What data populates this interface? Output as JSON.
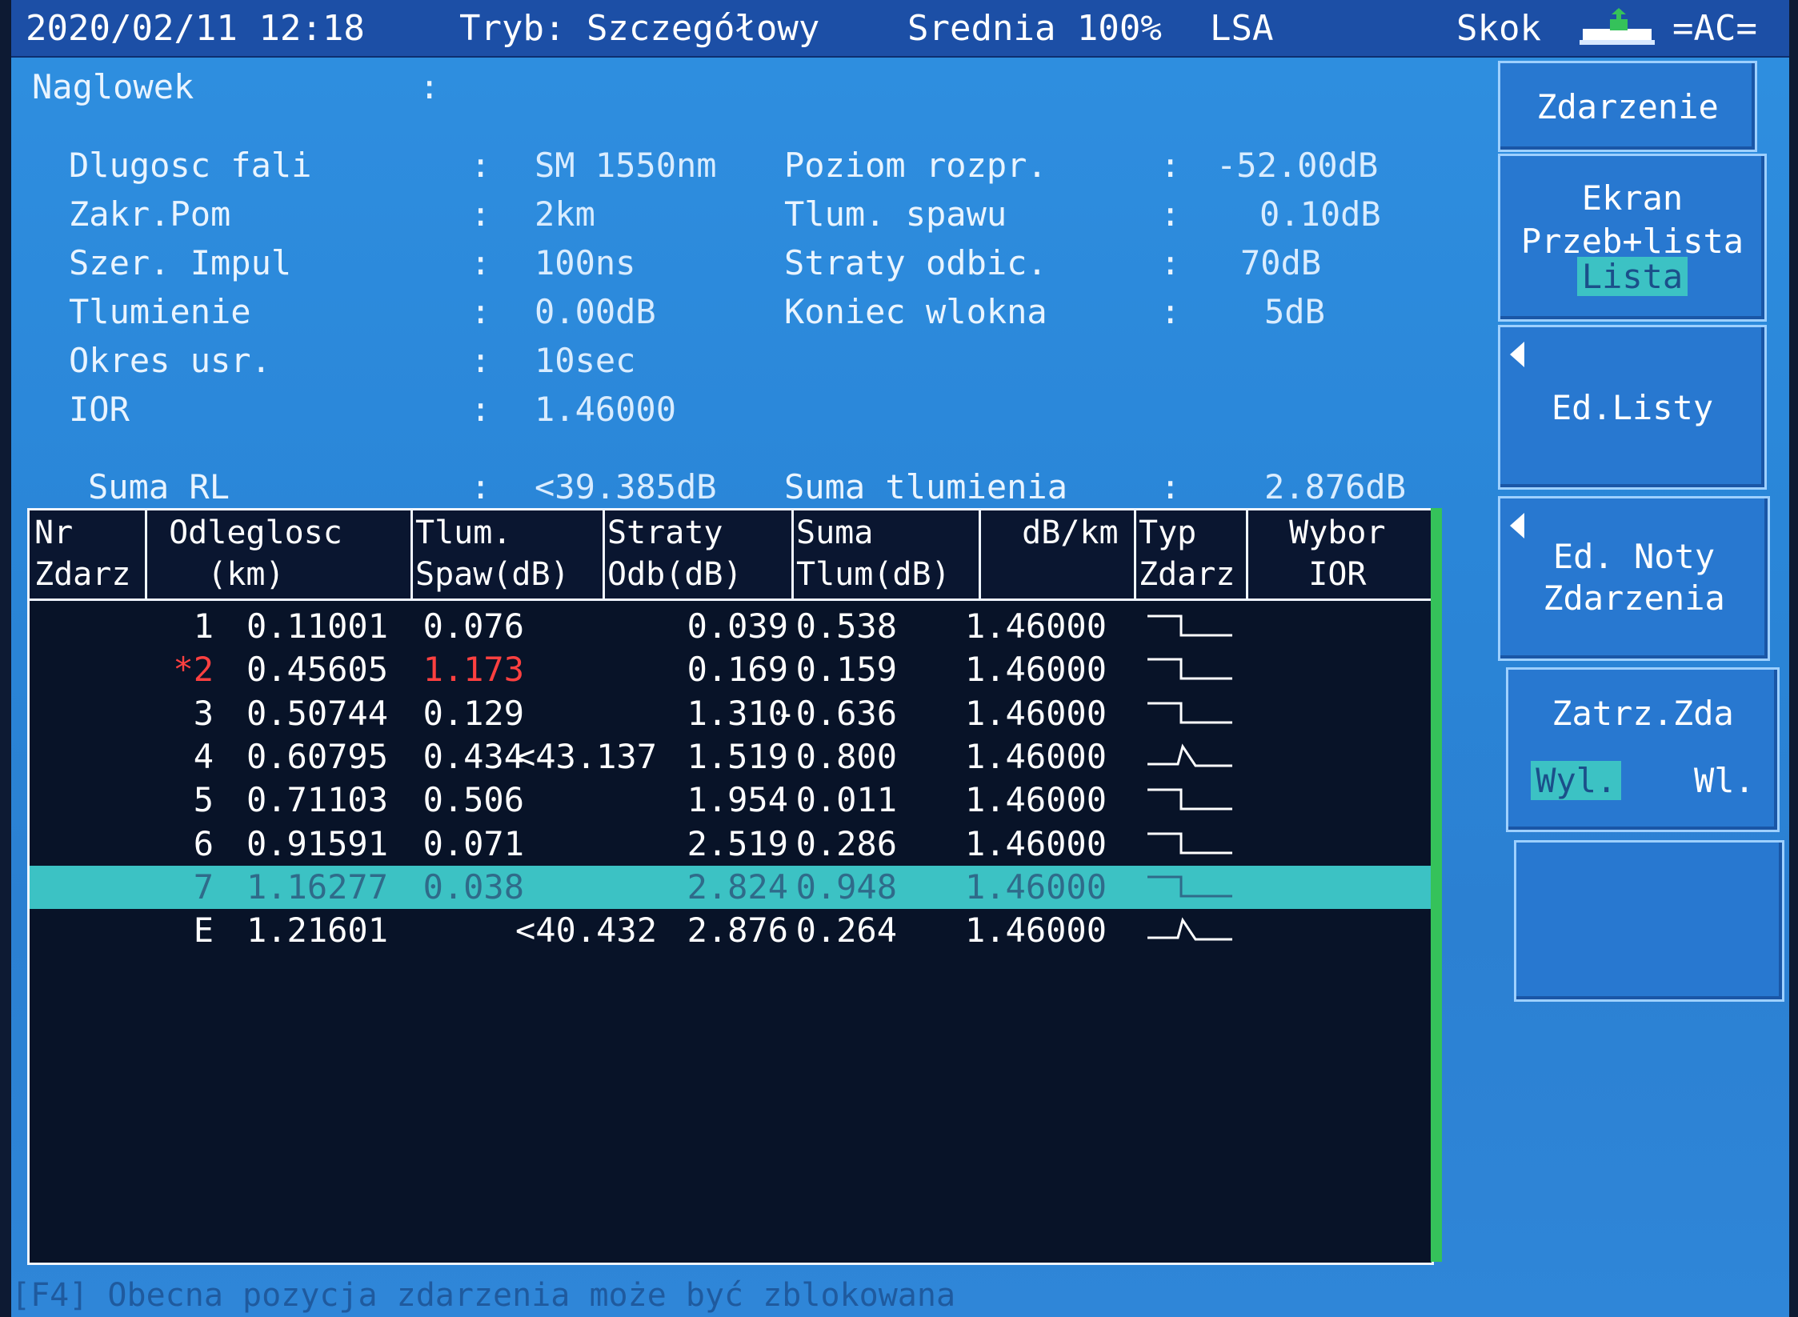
{
  "status": {
    "datetime": "2020/02/11 12:18",
    "mode": "Tryb: Szczegółowy",
    "average": "Srednia 100%",
    "lsa": "LSA",
    "skok": "Skok",
    "power": "=AC="
  },
  "header": {
    "title": "Naglowek",
    "title_colon": ":",
    "left": [
      {
        "label": "Dlugosc fali",
        "value": "SM 1550nm"
      },
      {
        "label": "Zakr.Pom",
        "value": "2km"
      },
      {
        "label": "Szer. Impul",
        "value": "100ns"
      },
      {
        "label": "Tlumienie",
        "value": "0.00dB"
      },
      {
        "label": "Okres usr.",
        "value": "10sec"
      },
      {
        "label": "IOR",
        "value": "1.46000"
      }
    ],
    "right": [
      {
        "label": "Poziom rozpr.",
        "value": "-52.00dB"
      },
      {
        "label": "Tlum. spawu",
        "value": "0.10dB"
      },
      {
        "label": "Straty odbic.",
        "value": "70dB"
      },
      {
        "label": "Koniec wlokna",
        "value": "5dB"
      }
    ],
    "suma_rl_label": "Suma RL",
    "suma_rl_value": "<39.385dB",
    "suma_tl_label": "Suma tlumienia",
    "suma_tl_value": "2.876dB",
    "colon": ":"
  },
  "table": {
    "columns": [
      "Nr\nZdarz",
      " Odleglosc\n   (km)",
      "Tlum.\nSpaw(dB)",
      "Straty\nOdb(dB)",
      "Suma\nTlum(dB)",
      "  dB/km",
      "Typ\nZdarz",
      "  Wybor\n   IOR"
    ],
    "rows": [
      {
        "nr": "1",
        "dist": "0.11001",
        "splice": "0.076",
        "refl": "",
        "total": "0.039",
        "dbkm": "0.538",
        "type": "step",
        "ior": "1.46000"
      },
      {
        "nr": "*2",
        "dist": "0.45605",
        "splice": "1.173",
        "refl": "",
        "total": "0.169",
        "dbkm": "0.159",
        "type": "step",
        "ior": "1.46000"
      },
      {
        "nr": "3",
        "dist": "0.50744",
        "splice": "0.129",
        "refl": "",
        "total": "1.310",
        "dbkm": "-0.636",
        "type": "step",
        "ior": "1.46000"
      },
      {
        "nr": "4",
        "dist": "0.60795",
        "splice": "0.434",
        "refl": "<43.137",
        "total": "1.519",
        "dbkm": "0.800",
        "type": "reflective",
        "ior": "1.46000"
      },
      {
        "nr": "5",
        "dist": "0.71103",
        "splice": "0.506",
        "refl": "",
        "total": "1.954",
        "dbkm": "0.011",
        "type": "step",
        "ior": "1.46000"
      },
      {
        "nr": "6",
        "dist": "0.91591",
        "splice": "0.071",
        "refl": "",
        "total": "2.519",
        "dbkm": "0.286",
        "type": "step",
        "ior": "1.46000"
      },
      {
        "nr": "7",
        "dist": "1.16277",
        "splice": "0.038",
        "refl": "",
        "total": "2.824",
        "dbkm": "0.948",
        "type": "step",
        "ior": "1.46000"
      },
      {
        "nr": "E",
        "dist": "1.21601",
        "splice": "",
        "refl": "<40.432",
        "total": "2.876",
        "dbkm": "0.264",
        "type": "reflective",
        "ior": "1.46000"
      }
    ]
  },
  "softkeys": {
    "event": "Zdarzenie",
    "screen_title": "Ekran",
    "screen_opt1": "Przeb+lista",
    "screen_opt2": "Lista",
    "edit_list": "Ed.Listy",
    "edit_notes_1": "Ed. Noty",
    "edit_notes_2": "Zdarzenia",
    "lock_title": "Zatrz.Zda",
    "lock_off": "Wyl.",
    "lock_on": "Wl."
  },
  "footer": "[F4]  Obecna pozycja zdarzenia może być zblokowana",
  "colors": {
    "screen_blue": "#2a86d8",
    "table_bg": "#081328",
    "selection": "#3cc2c4",
    "highlight_red": "#ff4040",
    "green_bar": "#35c25a"
  }
}
